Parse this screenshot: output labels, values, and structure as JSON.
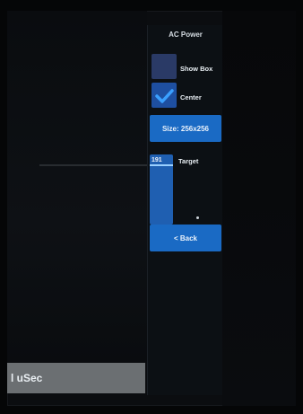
{
  "panel": {
    "title": "AC Power",
    "show_box": {
      "label": "Show Box",
      "checked": false
    },
    "center": {
      "label": "Center",
      "checked": true
    },
    "size_button": {
      "label": "Size: 256x256"
    },
    "target": {
      "value": "191",
      "label": "Target"
    },
    "back_button": {
      "label": "< Back"
    }
  },
  "status": {
    "label": "l uSec"
  },
  "colors": {
    "accent": "#1a6ac4",
    "checkbox_bg": "#2a3a66",
    "panel_bg": "#0c1014",
    "status_strip": "#6b6f72"
  },
  "icons": {
    "check": "checkmark-icon"
  }
}
